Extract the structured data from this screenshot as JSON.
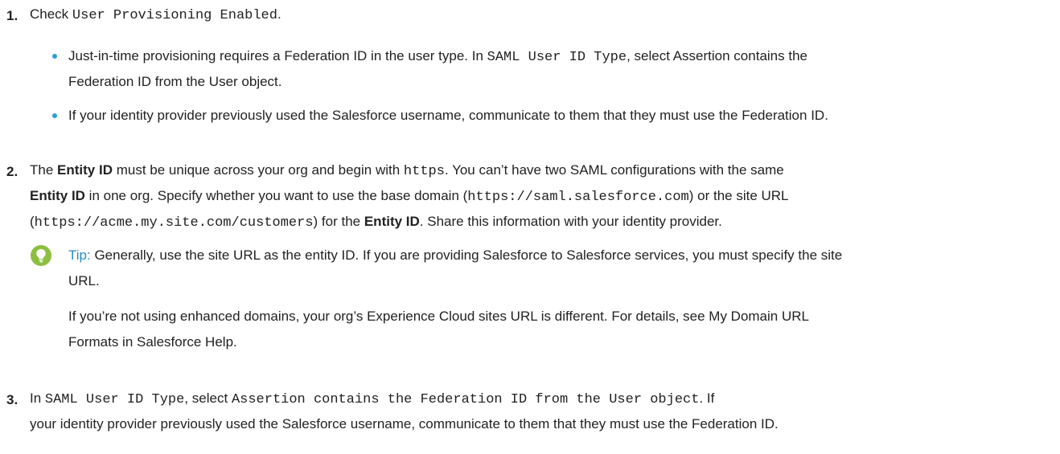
{
  "steps": [
    {
      "number": "1.",
      "pre": "Check ",
      "code": "User Provisioning Enabled",
      "post": ".",
      "bullets": [
        {
          "line1_pre": "Just-in-time provisioning requires a Federation ID in the user type. In ",
          "line1_code": "SAML User ID Type",
          "line1_post": ", select Assertion contains the",
          "line2": "Federation ID from the User object."
        },
        {
          "line1": "If your identity provider previously used the Salesforce username, communicate to them that they must use the Federation ID."
        }
      ]
    },
    {
      "number": "2.",
      "l1_a": "The ",
      "l1_b": "Entity ID",
      "l1_c": " must be unique across your org and begin with ",
      "l1_code": "https",
      "l1_d": ". You can’t have two SAML configurations with the same",
      "l2_a": "Entity ID",
      "l2_b": " in one org. Specify whether you want to use the base domain (",
      "l2_code": "https://saml.salesforce.com",
      "l2_c": ") or the site URL",
      "l3_a": "(",
      "l3_code": "https://acme.my.site.com/customers",
      "l3_b": ") for the ",
      "l3_c": "Entity ID",
      "l3_d": ". Share this information with your identity provider.",
      "tip": {
        "label": "Tip:",
        "line1": " Generally, use the site URL as the entity ID. If you are providing Salesforce to Salesforce services, you must specify the site",
        "line2": "URL.",
        "para_line1": "If you’re not using enhanced domains, your org’s Experience Cloud sites URL is different. For details, see My Domain URL",
        "para_line2": "Formats in Salesforce Help."
      }
    },
    {
      "number": "3.",
      "l1_a": "In ",
      "l1_code1": "SAML User ID Type",
      "l1_b": ", select ",
      "l1_code2": "Assertion contains the Federation ID from the User object",
      "l1_c": ". If",
      "l2": "your identity provider previously used the Salesforce username, communicate to them that they must use the Federation ID."
    }
  ],
  "colors": {
    "bullet": "#2a9fd8",
    "tip_label": "#2a8ac4",
    "tip_icon": "#8cbf3f"
  },
  "icons": {
    "tip": "lightbulb-icon"
  }
}
